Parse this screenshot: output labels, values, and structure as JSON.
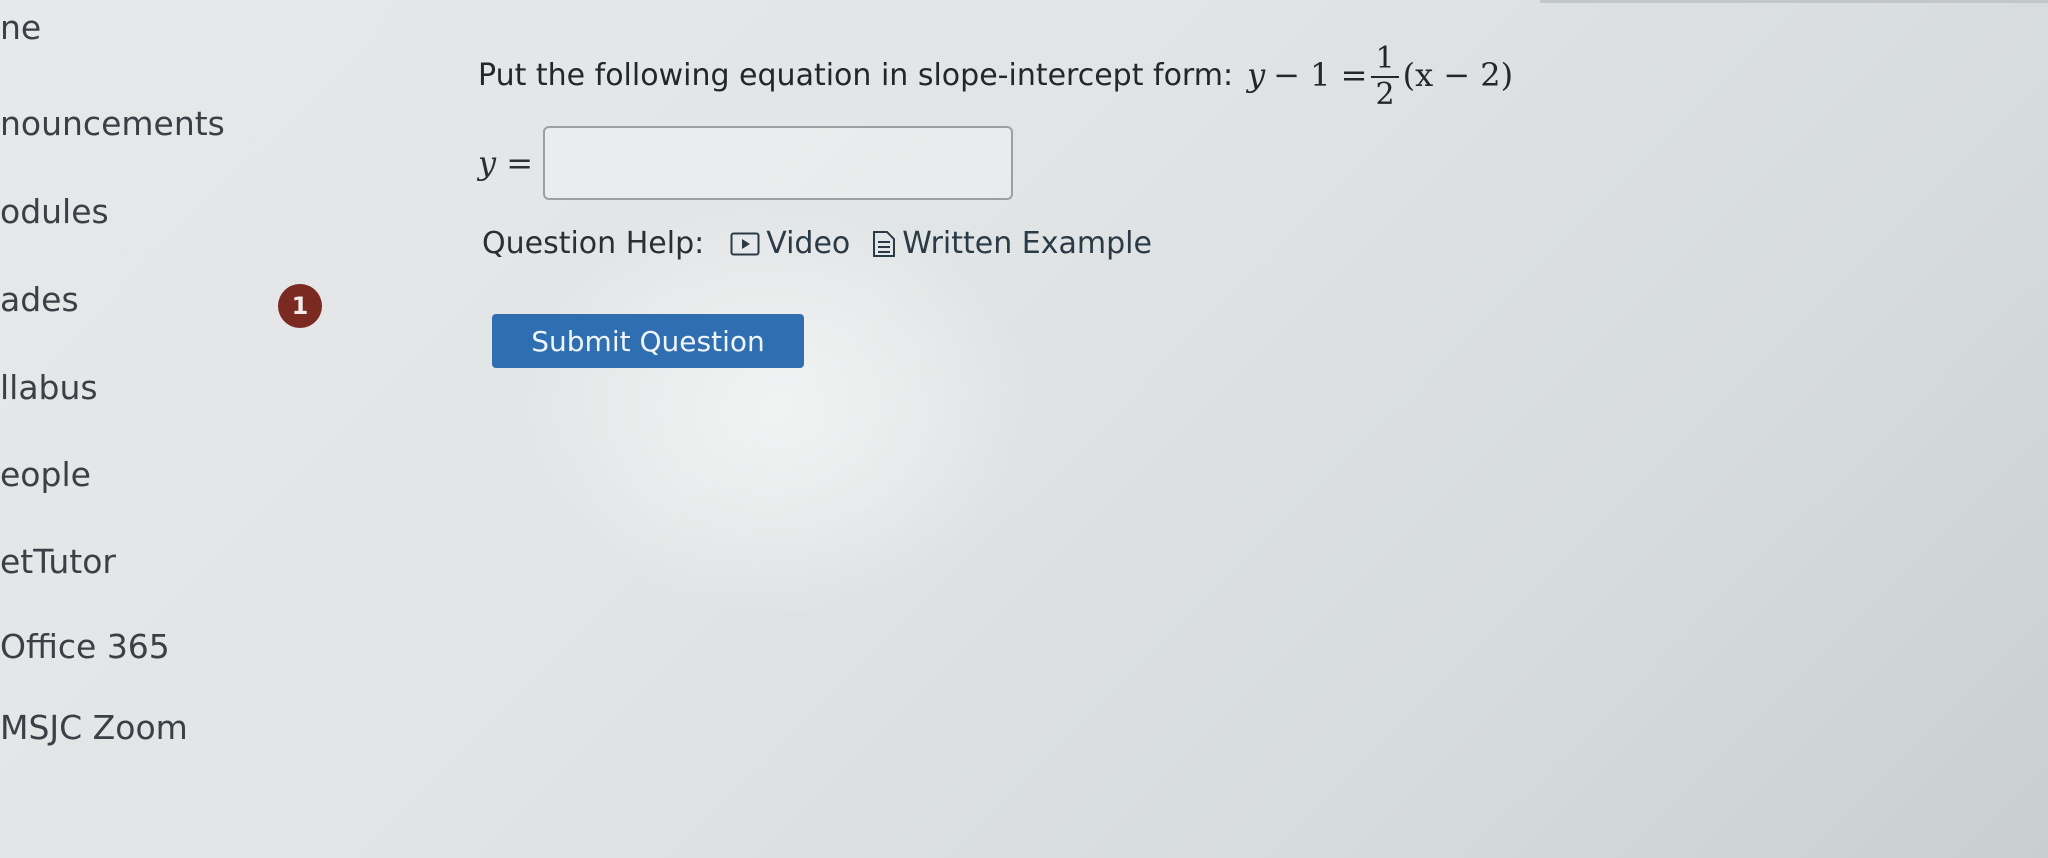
{
  "sidebar": {
    "items": [
      {
        "label": "ne"
      },
      {
        "label": "nouncements"
      },
      {
        "label": "odules"
      },
      {
        "label": "ades",
        "badge": "1"
      },
      {
        "label": "llabus"
      },
      {
        "label": "eople"
      },
      {
        "label": "etTutor"
      },
      {
        "label": "Office 365"
      },
      {
        "label": "MSJC Zoom"
      }
    ]
  },
  "question": {
    "prompt": "Put the following equation in slope-intercept form:",
    "lhs_var": "y",
    "lhs_rest": "− 1 =",
    "frac_num": "1",
    "frac_den": "2",
    "rhs": "(x − 2)"
  },
  "answer": {
    "label": "y =",
    "value": ""
  },
  "help": {
    "label": "Question Help:",
    "video_label": "Video",
    "written_label": "Written Example"
  },
  "submit": {
    "label": "Submit Question"
  },
  "colors": {
    "badge": "#7b2a22",
    "submit_button": "#2f6fb1"
  },
  "icons": {
    "video": "play-icon",
    "written": "document-icon"
  }
}
